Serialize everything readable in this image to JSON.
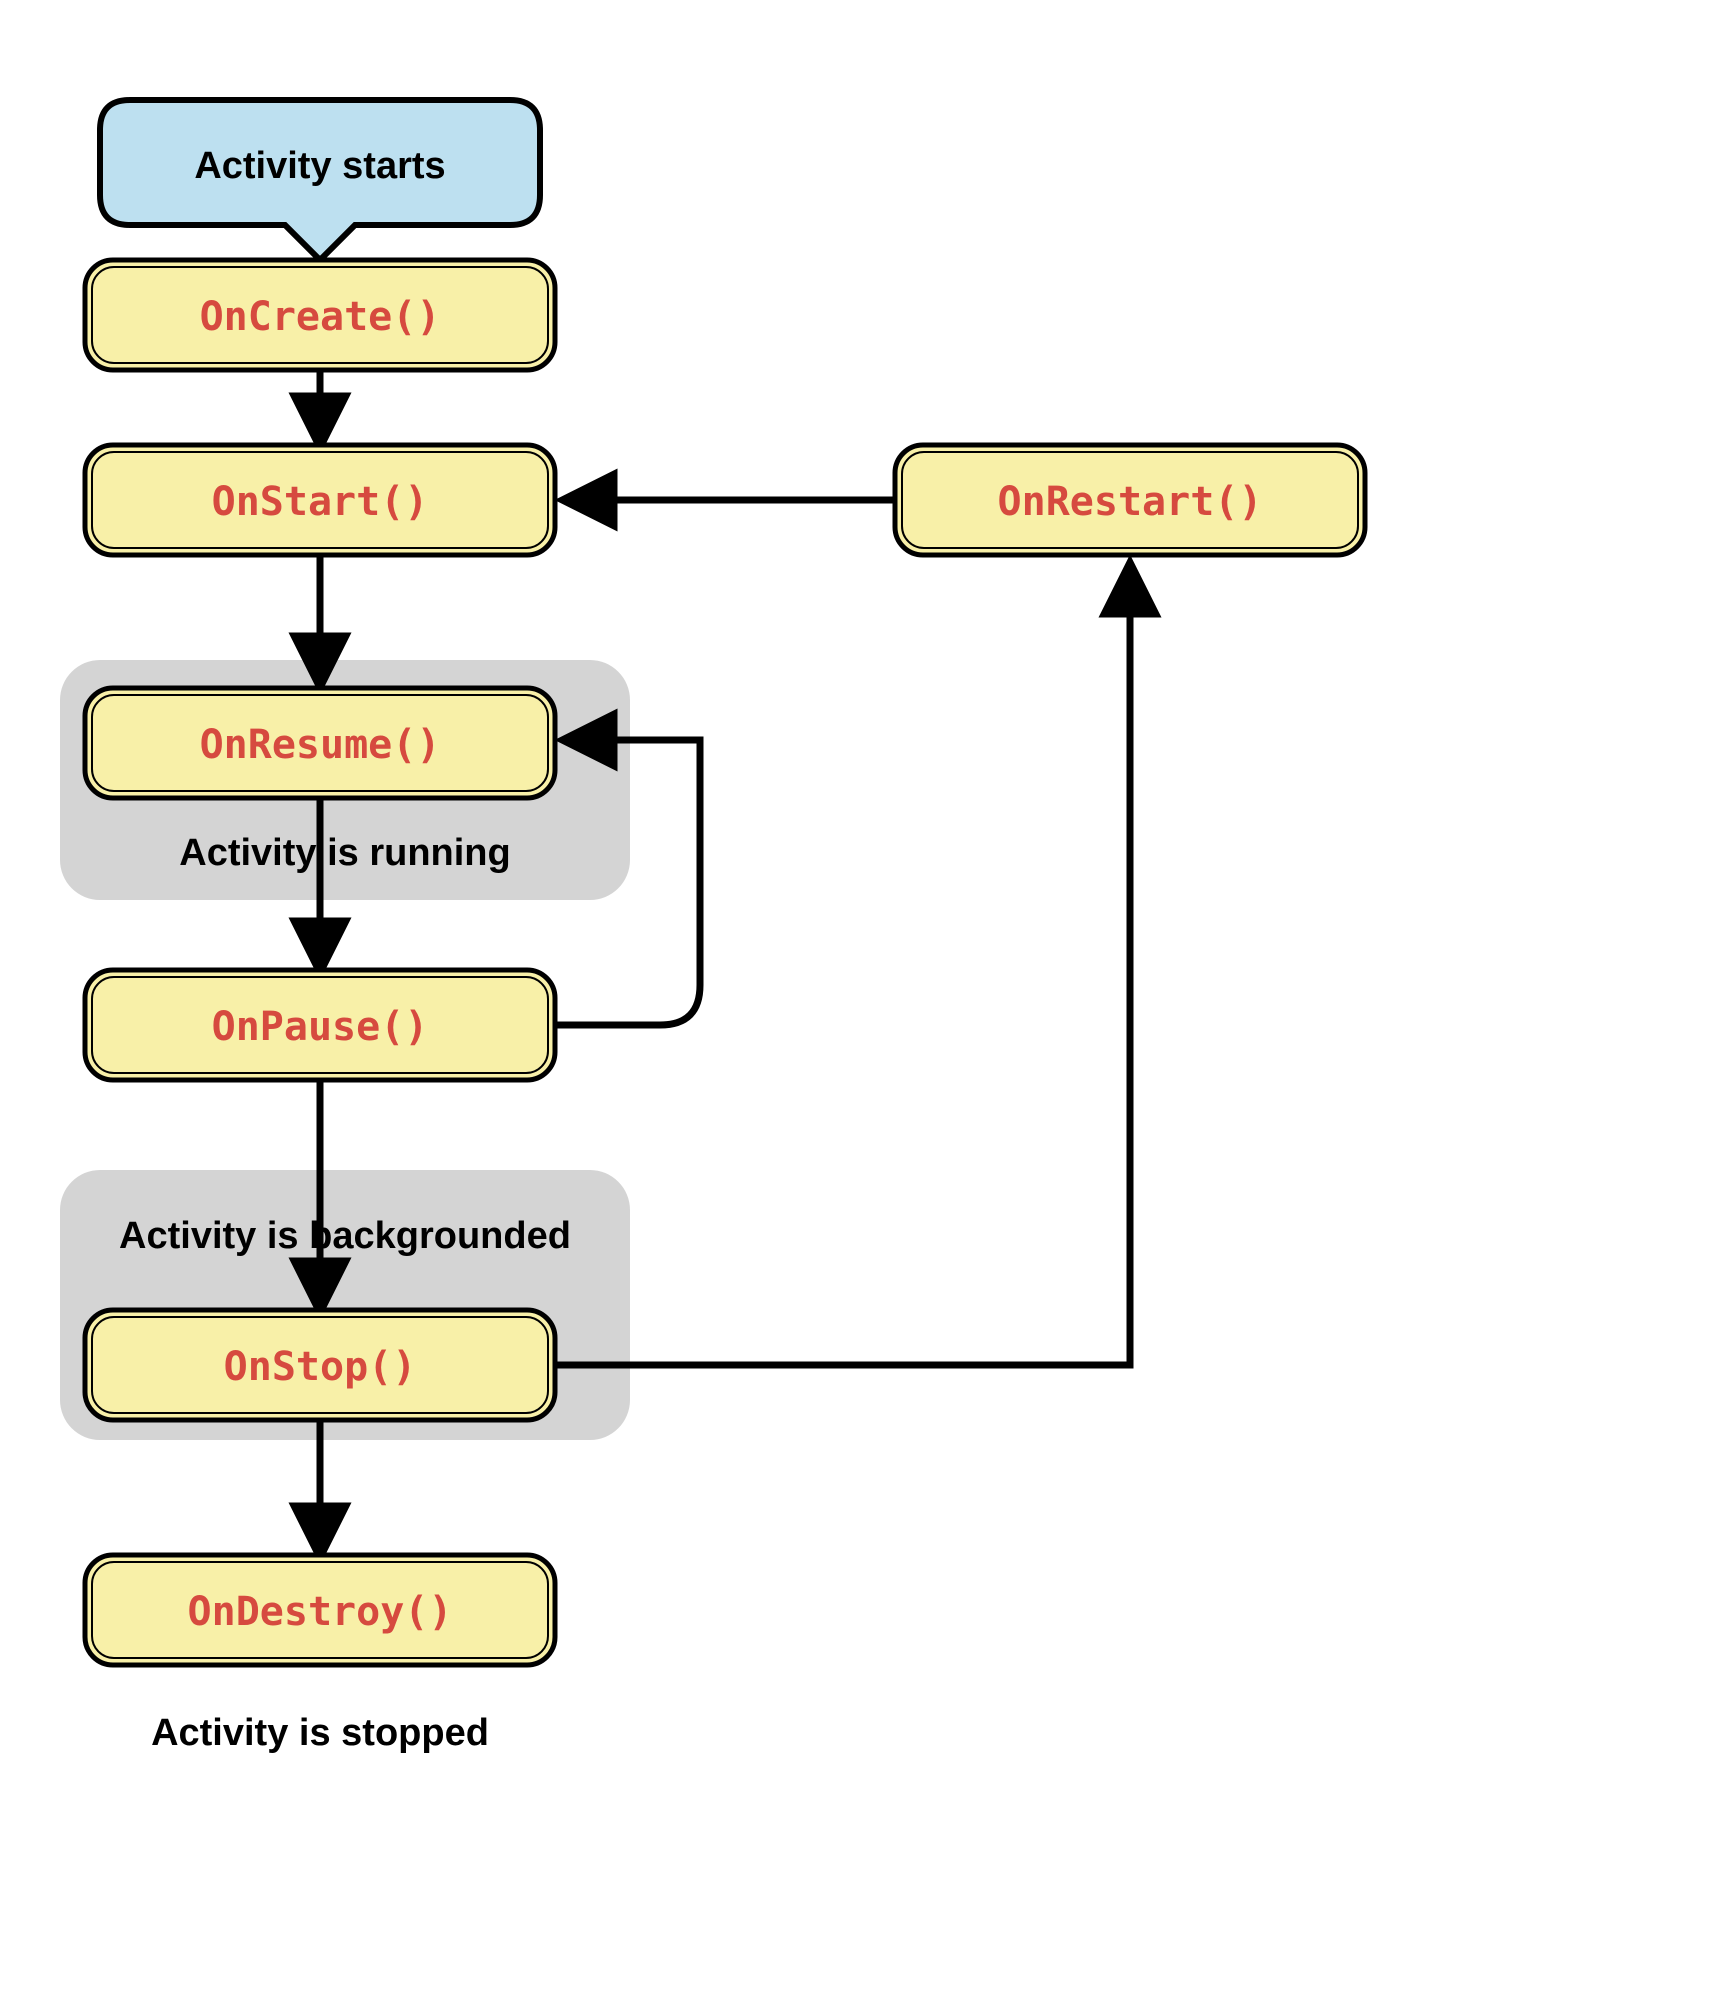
{
  "nodes": {
    "start": {
      "label": "Activity starts"
    },
    "onCreate": {
      "label": "OnCreate()"
    },
    "onStart": {
      "label": "OnStart()"
    },
    "onRestart": {
      "label": "OnRestart()"
    },
    "onResume": {
      "label": "OnResume()"
    },
    "onPause": {
      "label": "OnPause()"
    },
    "onStop": {
      "label": "OnStop()"
    },
    "onDestroy": {
      "label": "OnDestroy()"
    }
  },
  "groups": {
    "running": {
      "label": "Activity is running"
    },
    "backgrounded": {
      "label": "Activity is backgrounded"
    },
    "stopped": {
      "label": "Activity is stopped"
    }
  }
}
